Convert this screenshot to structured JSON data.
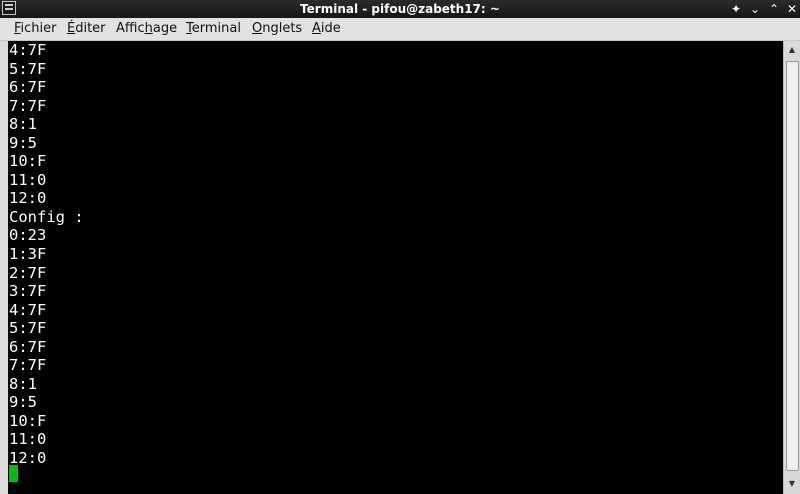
{
  "window": {
    "title": "Terminal - pifou@zabeth17: ~",
    "controls": {
      "sticky": "✦",
      "minimize": "⌄",
      "maximize": "⌃",
      "close": "✕"
    }
  },
  "menubar": {
    "items": [
      {
        "pre": "",
        "u": "F",
        "post": "ichier"
      },
      {
        "pre": "",
        "u": "É",
        "post": "diter"
      },
      {
        "pre": "Affic",
        "u": "h",
        "post": "age"
      },
      {
        "pre": "",
        "u": "T",
        "post": "erminal"
      },
      {
        "pre": "",
        "u": "O",
        "post": "nglets"
      },
      {
        "pre": "",
        "u": "A",
        "post": "ide"
      }
    ]
  },
  "terminal": {
    "lines": [
      "4:7F",
      "5:7F",
      "6:7F",
      "7:7F",
      "8:1",
      "9:5",
      "10:F",
      "11:0",
      "12:0",
      "Config :",
      "0:23",
      "1:3F",
      "2:7F",
      "3:7F",
      "4:7F",
      "5:7F",
      "6:7F",
      "7:7F",
      "8:1",
      "9:5",
      "10:F",
      "11:0",
      "12:0"
    ],
    "cursor_color": "#00c000"
  }
}
